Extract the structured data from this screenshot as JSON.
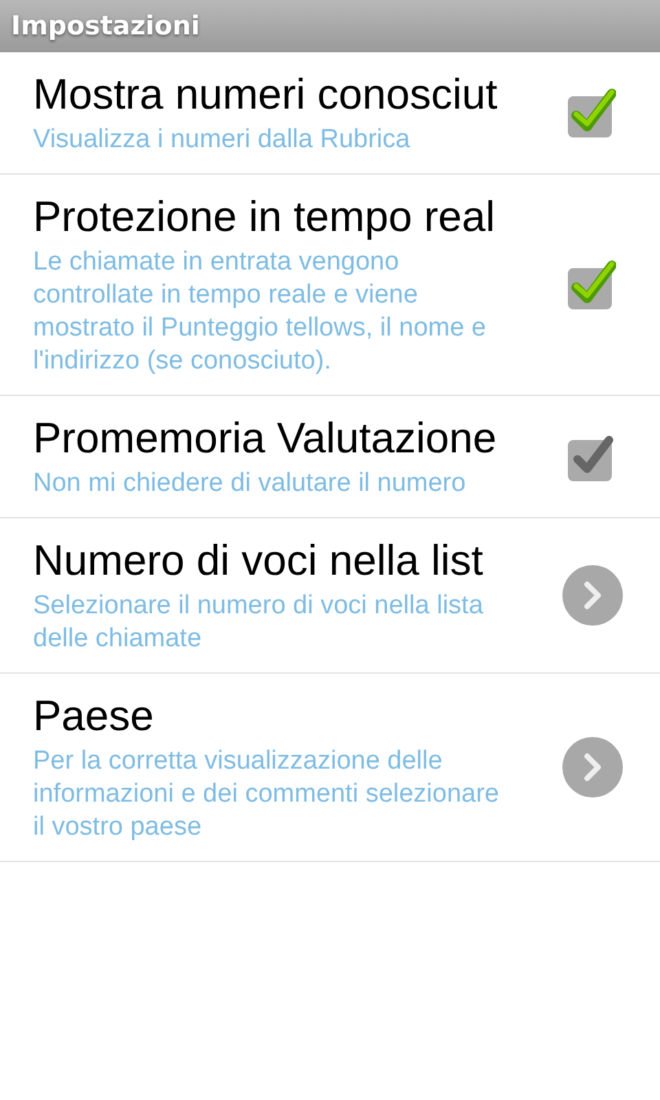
{
  "window": {
    "title": "Impostazioni"
  },
  "settings": [
    {
      "kind": "checkbox",
      "title": "Mostra numeri conosciut",
      "summary": "Visualizza i numeri dalla Rubrica",
      "checked": true
    },
    {
      "kind": "checkbox",
      "title": "Protezione in tempo real",
      "summary": "Le chiamate in entrata vengono controllate in tempo reale e viene mostrato il Punteggio tellows, il nome e l'indirizzo (se conosciuto).",
      "checked": true
    },
    {
      "kind": "checkbox",
      "title": "Promemoria Valutazione",
      "summary": "Non mi chiedere di valutare il numero",
      "checked": false
    },
    {
      "kind": "link",
      "title": "Numero di voci nella list",
      "summary": "Selezionare il numero di voci nella lista delle chiamate"
    },
    {
      "kind": "link",
      "title": "Paese",
      "summary": "Per la corretta visualizzazione delle informazioni e dei commenti selezionare il vostro paese"
    }
  ]
}
